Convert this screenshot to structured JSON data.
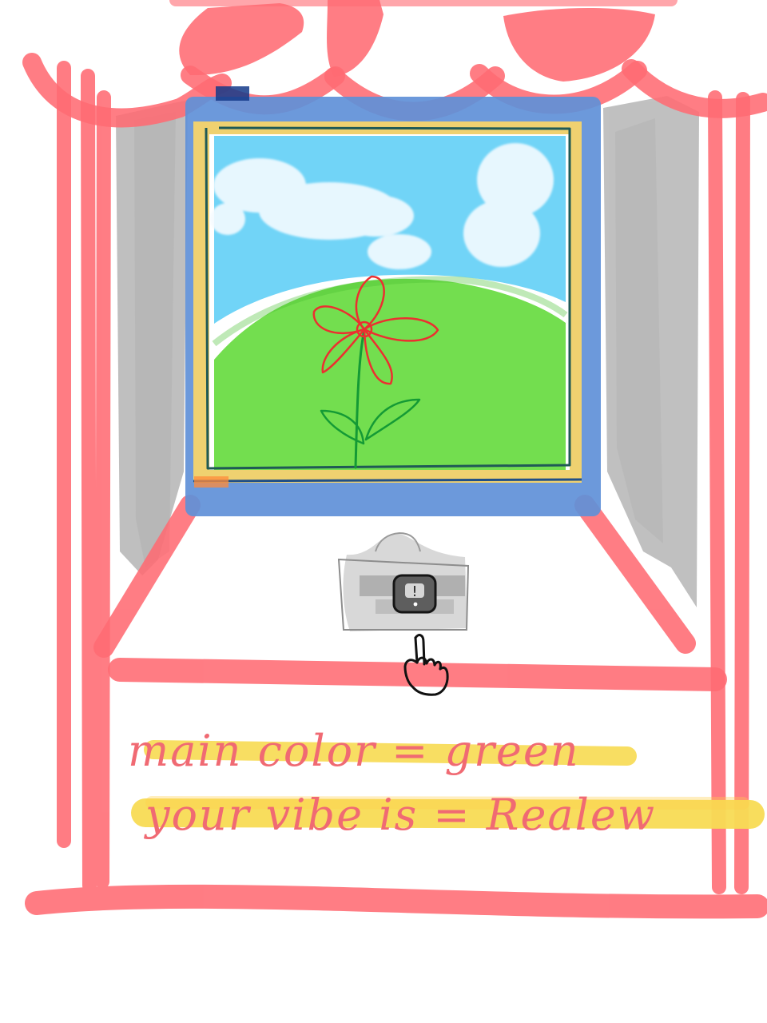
{
  "canvas": {
    "background": "#ffffff"
  },
  "colors": {
    "curtain_red": "#ff6b73",
    "curtain_dark_red": "#f44c5f",
    "side_curtain_gray": "#a8a8a8",
    "window_blue": "#5f90d8",
    "window_yellow": "#f5d36b",
    "sky_blue": "#69d2f7",
    "cloud_white": "#f4fbff",
    "grass_green": "#73de4f",
    "flower_red": "#ec2f30",
    "stem_green": "#149a35",
    "highlight_yellow": "#f8dc55"
  },
  "objects": {
    "camera": {
      "icon": "camera-icon",
      "mark": "!"
    },
    "cursor": {
      "icon": "pointer-hand-icon"
    }
  },
  "notes": {
    "line_1": "main color = green",
    "line_2": "your vibe is = Realew"
  }
}
